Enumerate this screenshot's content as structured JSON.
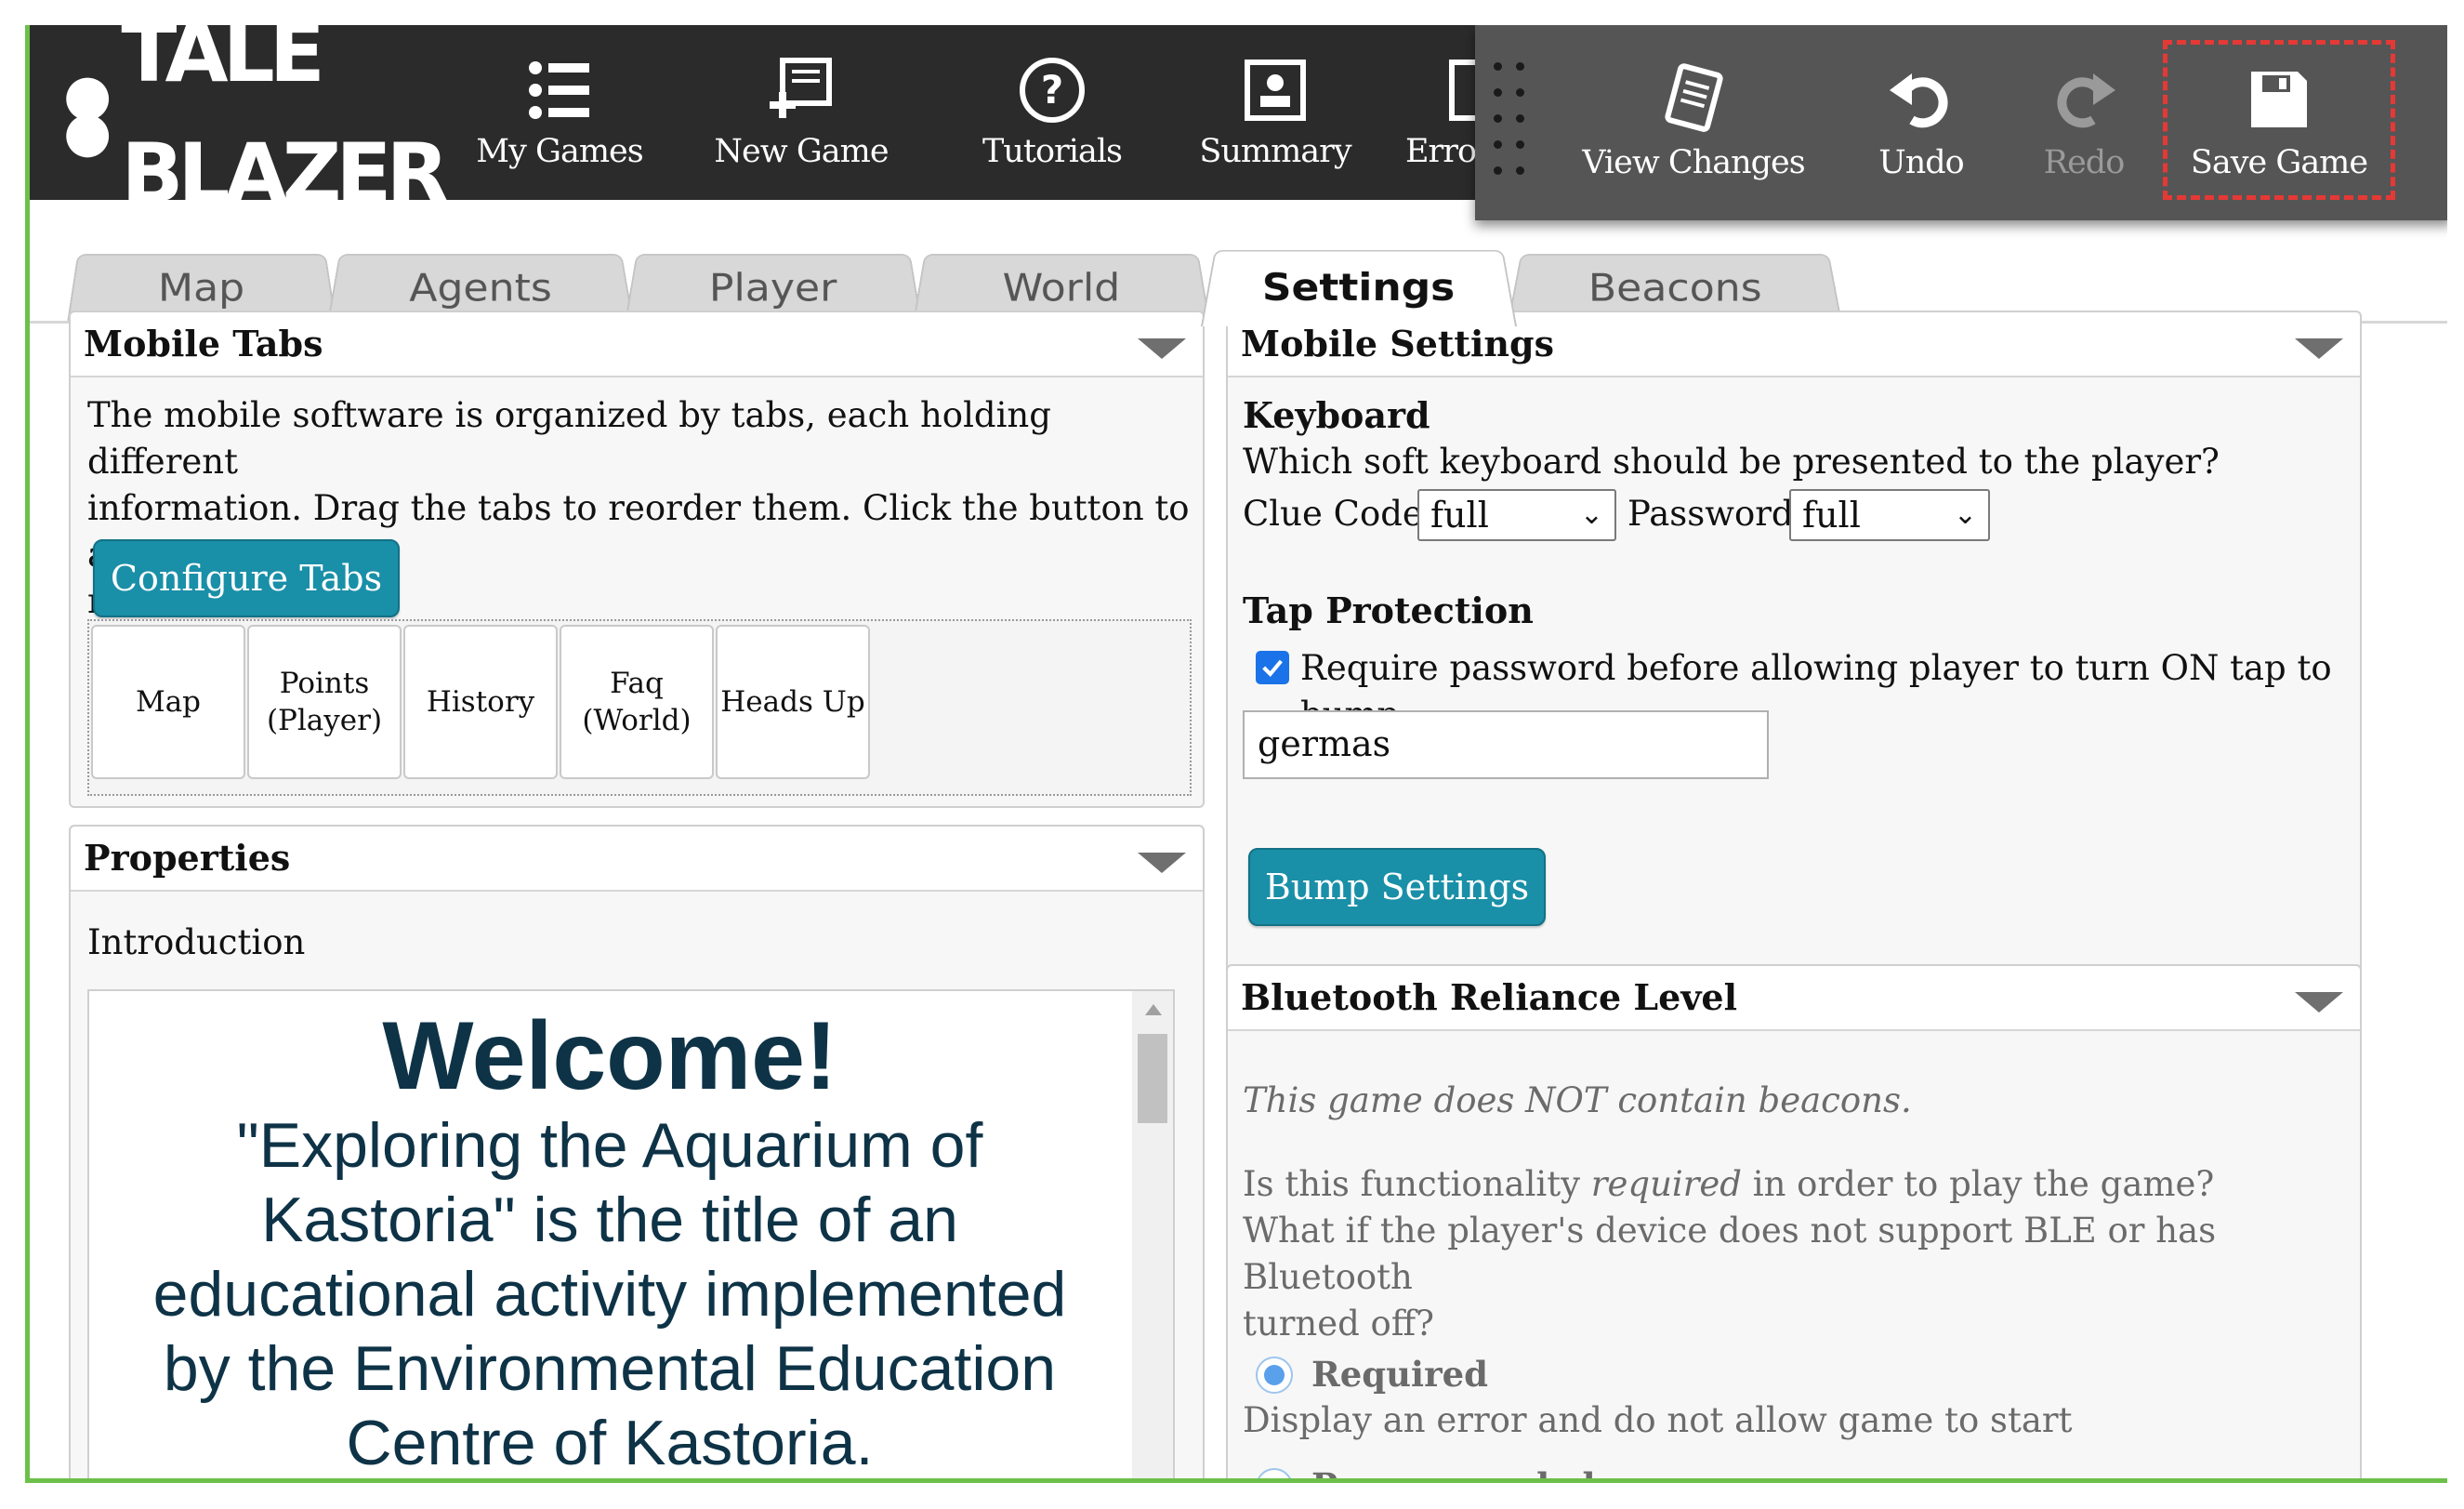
{
  "app": {
    "logo_text": "TALE BLAZER"
  },
  "nav": [
    {
      "label": "My Games",
      "icon": "list-icon"
    },
    {
      "label": "New Game",
      "icon": "new-game-icon"
    },
    {
      "label": "Tutorials",
      "icon": "help-icon"
    },
    {
      "label": "Summary",
      "icon": "summary-icon"
    },
    {
      "label": "Error",
      "icon": "errors-icon"
    }
  ],
  "toolbar": {
    "view_changes": "View Changes",
    "undo": "Undo",
    "redo": "Redo",
    "save": "Save Game",
    "redo_enabled": false
  },
  "tabs": [
    {
      "label": "Map"
    },
    {
      "label": "Agents"
    },
    {
      "label": "Player"
    },
    {
      "label": "World"
    },
    {
      "label": "Settings",
      "active": true
    },
    {
      "label": "Beacons"
    }
  ],
  "mobile_tabs": {
    "title": "Mobile Tabs",
    "description": "The mobile software is organized by tabs, each holding different information. Drag the tabs to reorder them. Click the button to add or remove tabs.",
    "desc_lines": [
      "The mobile software is organized by tabs, each holding different",
      "information. Drag the tabs to reorder them. Click the button to add or",
      "remove tabs."
    ],
    "configure_button": "Configure Tabs",
    "items": [
      {
        "line1": "Map",
        "line2": ""
      },
      {
        "line1": "Points",
        "line2": "(Player)"
      },
      {
        "line1": "History",
        "line2": ""
      },
      {
        "line1": "Faq",
        "line2": "(World)"
      },
      {
        "line1": "Heads Up",
        "line2": ""
      }
    ]
  },
  "properties": {
    "title": "Properties",
    "intro_label": "Introduction",
    "intro_heading": "Welcome!",
    "intro_lines": [
      "\"Exploring the Aquarium of",
      "Kastoria\" is the title of an",
      "educational activity implemented",
      "by the Environmental Education",
      "Centre of Kastoria."
    ]
  },
  "mobile_settings": {
    "title": "Mobile Settings",
    "keyboard_heading": "Keyboard",
    "keyboard_question": "Which soft keyboard should be presented to the player?",
    "clue_code_label": "Clue Code",
    "clue_code_value": "full",
    "password_label": "Password",
    "password_value": "full",
    "tap_heading": "Tap Protection",
    "tap_checkbox_label": "Require password before allowing player to turn ON tap to bump",
    "tap_checked": true,
    "tap_password": "germas",
    "bump_button": "Bump Settings"
  },
  "bluetooth": {
    "title": "Bluetooth Reliance Level",
    "no_beacons": "This game does NOT contain beacons.",
    "q_prefix": "Is this functionality ",
    "q_em": "required",
    "q_suffix": " in order to play the game?",
    "q2_line1": "What if the player's device does not support BLE or has Bluetooth",
    "q2_line2": "turned off?",
    "option_required": "Required",
    "option_required_desc": "Display an error and do not allow game to start",
    "option_recommended": "Recommended"
  },
  "colors": {
    "header_bg": "#2b2b2b",
    "toolbar_bg": "#555555",
    "accent_teal": "#1a8fa8",
    "frame_green": "#6cc04a",
    "save_outline": "#e53935",
    "intro_text": "#0e3347"
  }
}
